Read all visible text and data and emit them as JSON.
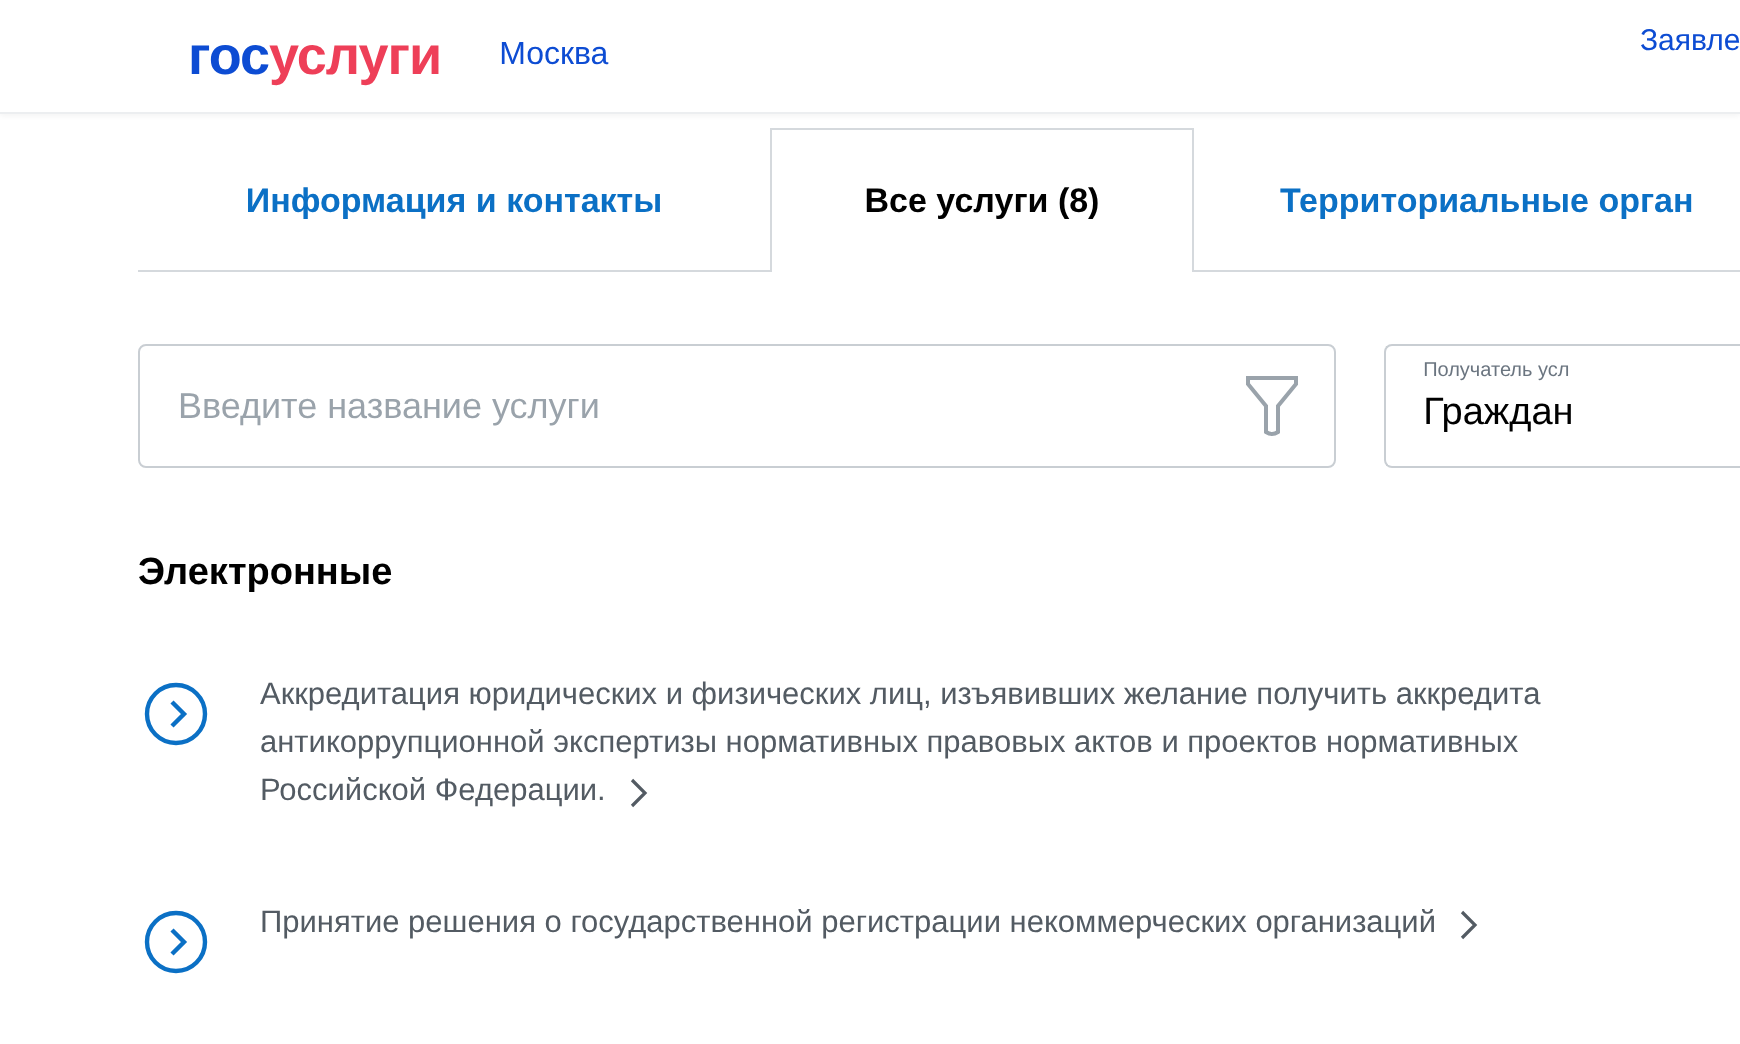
{
  "header": {
    "logo": {
      "part_1": "гос",
      "part_2": "услуги"
    },
    "city": "Москва",
    "nav_link": "Заявле"
  },
  "tabs": [
    {
      "label": "Информация и контакты",
      "selected": false
    },
    {
      "label": "Все услуги (8)",
      "selected": true
    },
    {
      "label": "Территориальные орган",
      "selected": false
    }
  ],
  "search": {
    "placeholder": "Введите название услуги"
  },
  "recipient": {
    "label": "Получатель усл",
    "value": "Граждан"
  },
  "section": {
    "title": "Электронные"
  },
  "services": [
    {
      "lines": [
        "Аккредитация юридических и физических лиц, изъявивших желание получить аккредита",
        "антикоррупционной экспертизы нормативных правовых актов и проектов нормативных",
        "Российской Федерации."
      ]
    },
    {
      "lines": [
        "Принятие решения о государственной регистрации некоммерческих организаций"
      ]
    }
  ]
}
